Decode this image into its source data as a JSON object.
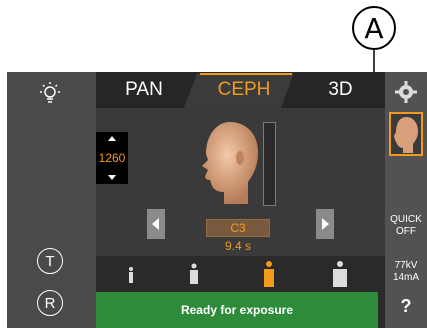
{
  "callout": {
    "label": "A"
  },
  "tabs": [
    {
      "label": "PAN"
    },
    {
      "label": "CEPH"
    },
    {
      "label": "3D"
    }
  ],
  "active_tab": "CEPH",
  "field": {
    "value": "1260"
  },
  "region": {
    "label": "C3",
    "time": "9.4 s"
  },
  "status": {
    "text": "Ready for exposure"
  },
  "right_panel": {
    "quick_line1": "QUICK",
    "quick_line2": "OFF",
    "kv": "77kV",
    "ma": "14mA",
    "help": "?"
  },
  "left_panel": {
    "t_button": "T",
    "r_button": "R"
  },
  "colors": {
    "accent": "#f29a1e",
    "ready_green": "#2e8b3a",
    "panel": "#4a4a4a",
    "screen_bg": "#2b2b2b"
  },
  "icons": [
    "light-bulb-icon",
    "gear-icon",
    "left-arrow-icon",
    "right-arrow-icon",
    "patient-size-icons"
  ]
}
